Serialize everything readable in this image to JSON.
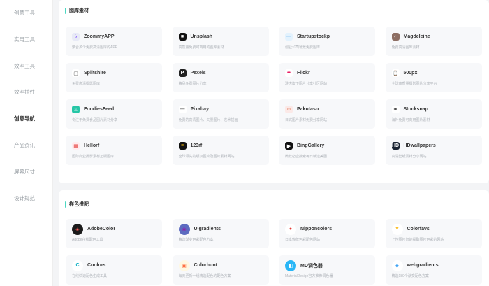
{
  "sidebar": {
    "items": [
      {
        "label": "创意工具",
        "active": false
      },
      {
        "label": "实用工具",
        "active": false
      },
      {
        "label": "效率工具",
        "active": false
      },
      {
        "label": "效率插件",
        "active": false
      },
      {
        "label": "创意导航",
        "active": true
      },
      {
        "label": "产品资讯",
        "active": false
      },
      {
        "label": "屏幕尺寸",
        "active": false
      },
      {
        "label": "设计规范",
        "active": false
      }
    ]
  },
  "sections": [
    {
      "title": "图库素材",
      "cards": [
        {
          "name": "ZoommyAPP",
          "desc": "聚合多个免费高清图库的APP",
          "icon": "zoommy-icon",
          "color": "#e8eaf6",
          "glyph": "ϟ",
          "fg": "#7c4dff"
        },
        {
          "name": "Unsplash",
          "desc": "高质量免费可商用的图库素材",
          "icon": "unsplash-icon",
          "color": "#111111",
          "glyph": "■",
          "fg": "#ffffff"
        },
        {
          "name": "Startupstockp",
          "desc": "创业公司场景免费图库",
          "icon": "startup-icon",
          "color": "#e3f2fd",
          "glyph": "—",
          "fg": "#1e88e5"
        },
        {
          "name": "Magdeleine",
          "desc": "免费高清图库素材",
          "icon": "magdeleine-icon",
          "color": "#8d6e63",
          "glyph": "◐",
          "fg": "#ffffff"
        },
        {
          "name": "Splitshire",
          "desc": "免费高清摄影图库",
          "icon": "splitshire-icon",
          "color": "#ffffff",
          "glyph": "▢",
          "fg": "#555555"
        },
        {
          "name": "Pexels",
          "desc": "精品免费图片分享",
          "icon": "pexels-icon",
          "color": "#222222",
          "glyph": "P",
          "fg": "#ffffff"
        },
        {
          "name": "Flickr",
          "desc": "雅虎旗下图片分享社区网站",
          "icon": "flickr-icon",
          "color": "#ffffff",
          "glyph": "••",
          "fg": "#e91e63"
        },
        {
          "name": "500px",
          "desc": "全球高质量摄影图片分享平台",
          "icon": "500px-icon",
          "color": "#ffffff",
          "glyph": "⌚",
          "fg": "#555555"
        },
        {
          "name": "FoodiesFeed",
          "desc": "专注于免费食品图片素材分享",
          "icon": "foodiesfeed-icon",
          "color": "#26c6a6",
          "glyph": "♨",
          "fg": "#ffffff"
        },
        {
          "name": "Pixabay",
          "desc": "免费的高清图片、矢量图片、艺术插画",
          "icon": "pixabay-icon",
          "color": "#ffffff",
          "glyph": "—",
          "fg": "#666666"
        },
        {
          "name": "Pakutaso",
          "desc": "日式图片素材免费分享网站",
          "icon": "pakutaso-icon",
          "color": "#fbe9e7",
          "glyph": "☺",
          "fg": "#d84315"
        },
        {
          "name": "Stocksnap",
          "desc": "海外免费可商用图片素材",
          "icon": "stocksnap-icon",
          "color": "#ffffff",
          "glyph": "◙",
          "fg": "#444444"
        },
        {
          "name": "Hellorf",
          "desc": "国际商业摄影素材正版图库",
          "icon": "hellorf-icon",
          "color": "#ffebee",
          "glyph": "▦",
          "fg": "#e53935"
        },
        {
          "name": "123rf",
          "desc": "全球领先的版权图片及图片素材网站",
          "icon": "123rf-icon",
          "color": "#111111",
          "glyph": "≡",
          "fg": "#ffc107"
        },
        {
          "name": "BingGallery",
          "desc": "微软必应搜索每日精选美图",
          "icon": "binggallery-icon",
          "color": "#111111",
          "glyph": "▶",
          "fg": "#ffffff"
        },
        {
          "name": "HDwallpapers",
          "desc": "高清壁纸素材分享网站",
          "icon": "hdwallpapers-icon",
          "color": "#1a2433",
          "glyph": "HD",
          "fg": "#ffffff"
        }
      ]
    },
    {
      "title": "样色搭配",
      "cards": [
        {
          "name": "AdobeColor",
          "desc": "Adobe在线配色工具",
          "icon": "adobecolor-icon",
          "color": "#1b1b1b",
          "glyph": "◈",
          "fg": "#ff5c5c"
        },
        {
          "name": "Uigradients",
          "desc": "精选渐变色彩配色方案",
          "icon": "uigradients-icon",
          "color": "#5c6bc0",
          "glyph": "◉",
          "fg": "#8e24aa"
        },
        {
          "name": "Nipponcolors",
          "desc": "日本传统色彩配色网站",
          "icon": "nipponcolors-icon",
          "color": "#ffffff",
          "glyph": "●",
          "fg": "#e53935"
        },
        {
          "name": "Colorfavs",
          "desc": "上传图片智能提取图片色彩的网站",
          "icon": "colorfavs-icon",
          "color": "#ffffff",
          "glyph": "▼",
          "fg": "#fbc02d"
        },
        {
          "name": "Coolors",
          "desc": "在线快速配色生成工具",
          "icon": "coolors-icon",
          "color": "#ffffff",
          "glyph": "C",
          "fg": "#00acc1"
        },
        {
          "name": "Colorhunt",
          "desc": "每天更新一组精选配色的配色方案",
          "icon": "colorhunt-icon",
          "color": "#fff8e1",
          "glyph": "▣",
          "fg": "#ff7043"
        },
        {
          "name": "MD调色器",
          "desc": "MaterialDesign官方推荐调色器",
          "icon": "mdpalette-icon",
          "color": "#29b6f6",
          "glyph": "◧",
          "fg": "#ffffff"
        },
        {
          "name": "webgradients",
          "desc": "精选180个渐变配色方案",
          "icon": "webgradients-icon",
          "color": "#ffffff",
          "glyph": "◆",
          "fg": "#42a5f5"
        }
      ]
    }
  ]
}
